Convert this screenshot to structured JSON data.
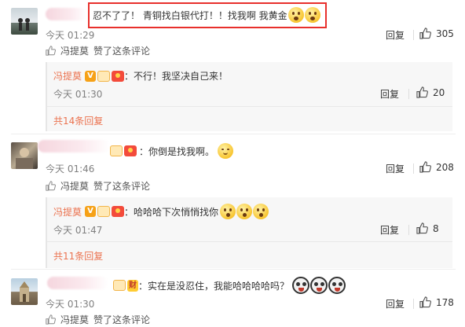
{
  "comments": [
    {
      "text": "忍不了了！ 青铜找白银代打！！找我啊 我黄金",
      "time": "今天 01:29",
      "reply_label": "回复",
      "likes": "305",
      "liked_by": "冯提莫",
      "liked_suffix": "赞了这条评论",
      "sub_reply": {
        "author": "冯提莫",
        "text": "：不行！我坚决自己来！",
        "time": "今天 01:30",
        "reply_label": "回复",
        "likes": "20"
      },
      "total_replies": "共14条回复"
    },
    {
      "text": "你倒是找我啊。",
      "time": "今天 01:46",
      "reply_label": "回复",
      "likes": "208",
      "liked_by": "冯提莫",
      "liked_suffix": "赞了这条评论",
      "sub_reply": {
        "author": "冯提莫",
        "text": "：哈哈哈下次悄悄找你",
        "time": "今天 01:47",
        "reply_label": "回复",
        "likes": "8"
      },
      "total_replies": "共11条回复"
    },
    {
      "text": "：实在是没忍住，我能哈哈哈哈吗？",
      "badge_text": "财",
      "time": "今天 01:30",
      "reply_label": "回复",
      "likes": "178",
      "liked_by": "冯提莫",
      "liked_suffix": "赞了这条评论"
    }
  ],
  "badges": {
    "verified": "V"
  },
  "colors": {
    "accent": "#eb7350",
    "highlight": "#e8302c"
  }
}
